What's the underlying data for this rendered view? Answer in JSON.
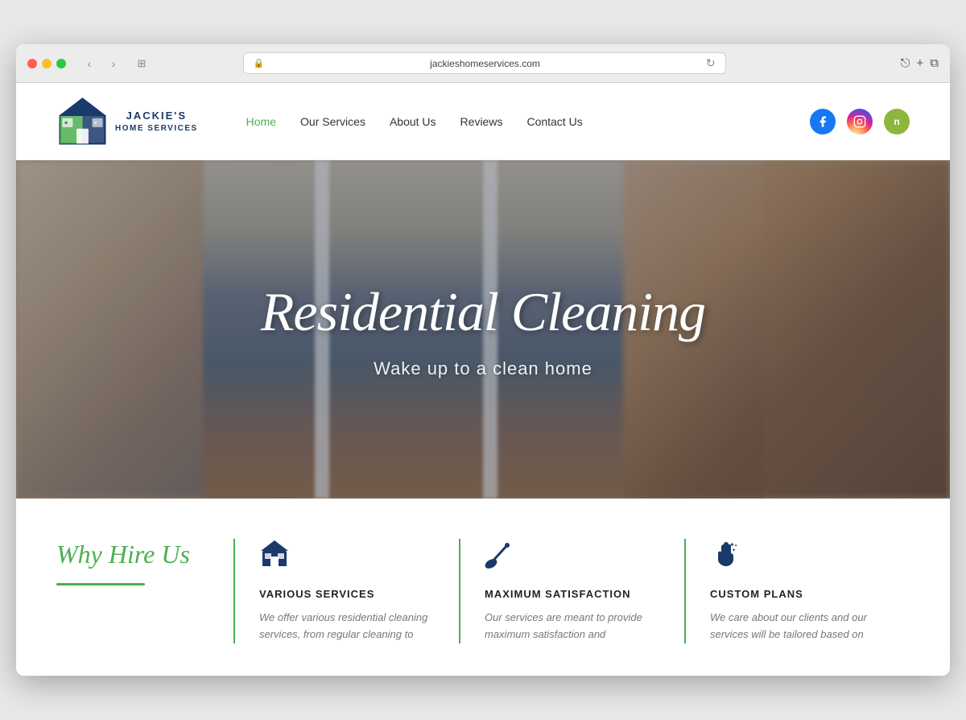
{
  "browser": {
    "url": "jackieshomeservices.com",
    "traffic_lights": [
      "red",
      "yellow",
      "green"
    ]
  },
  "nav": {
    "logo_name": "JACKIE'S",
    "logo_sub": "HOME SERVICES",
    "links": [
      {
        "label": "Home",
        "active": true
      },
      {
        "label": "Our Services",
        "active": false
      },
      {
        "label": "About Us",
        "active": false
      },
      {
        "label": "Reviews",
        "active": false
      },
      {
        "label": "Contact Us",
        "active": false
      }
    ],
    "social": [
      {
        "name": "Facebook",
        "type": "facebook"
      },
      {
        "name": "Instagram",
        "type": "instagram"
      },
      {
        "name": "Nextdoor",
        "type": "nextdoor",
        "label": "n"
      }
    ]
  },
  "hero": {
    "title": "Residential Cleaning",
    "subtitle": "Wake up to a clean home"
  },
  "why": {
    "section_title": "Why Hire Us",
    "cards": [
      {
        "icon": "house",
        "title": "VARIOUS SERVICES",
        "text": "We offer various residential cleaning services, from regular cleaning to"
      },
      {
        "icon": "broom",
        "title": "MAXIMUM SATISFACTION",
        "text": "Our services are meant to provide maximum satisfaction and"
      },
      {
        "icon": "hand",
        "title": "CUSTOM PLANS",
        "text": "We care about our clients and our services will be tailored based on"
      }
    ]
  }
}
